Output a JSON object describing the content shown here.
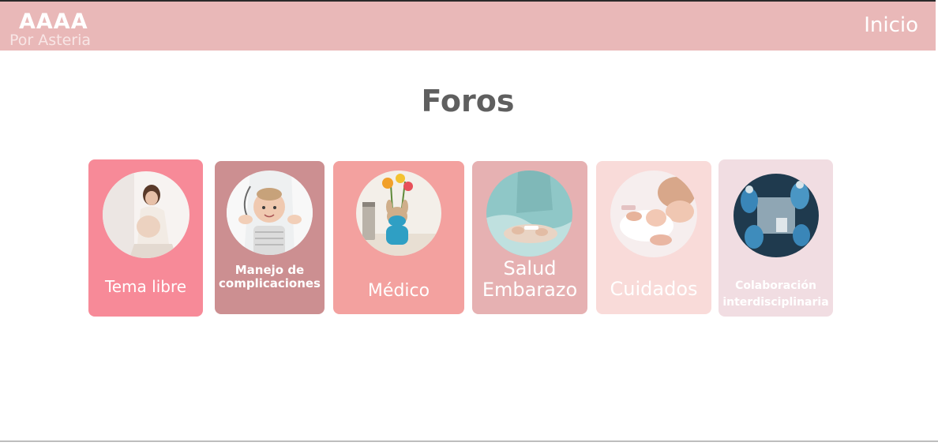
{
  "header": {
    "brand": "AAAA",
    "subtitle": "Por Asteria",
    "nav_home": "Inicio"
  },
  "page": {
    "title": "Foros"
  },
  "forums": [
    {
      "label": "Tema libre",
      "icon": "pregnant-woman-photo"
    },
    {
      "label_line1": "Manejo de",
      "label_line2": "complicaciones",
      "icon": "baby-doctor-photo"
    },
    {
      "label": "Médico",
      "icon": "plush-toy-flowers-photo"
    },
    {
      "label_line1": "Salud",
      "label_line2": "Embarazo",
      "icon": "pregnancy-test-photo"
    },
    {
      "label": "Cuidados",
      "icon": "newborn-care-photo"
    },
    {
      "label_line1": "Colaboración",
      "label_line2": "interdisciplinaria",
      "icon": "medical-team-photo"
    }
  ],
  "colors": {
    "header_bg": "#e9b8b8",
    "card1": "#f78a98",
    "card2": "#cc8f91",
    "card3": "#f3a19f",
    "card4": "#e6b1b2",
    "card5": "#f9dbd9",
    "card6": "#f1dde2",
    "title": "#5f5f5f"
  }
}
